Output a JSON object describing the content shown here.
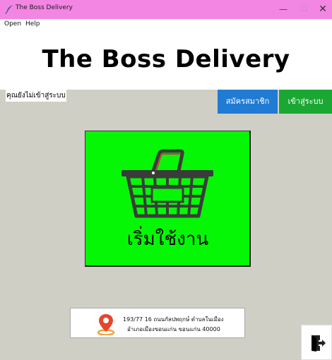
{
  "window": {
    "title": "The Boss Delivery",
    "controls": {
      "minimize": "—",
      "maximize": "☐",
      "close": "✕"
    }
  },
  "menu": {
    "items": [
      "Open",
      "Help"
    ]
  },
  "header": {
    "brand": "The Boss Delivery"
  },
  "status": {
    "text": "คุณยังไม่เข้าสู่ระบบ"
  },
  "actions": {
    "register_label": "สมัครสมาชิก",
    "login_label": "เข้าสู่ระบบ"
  },
  "start": {
    "label": "เริ่มใช้งาน",
    "icon": "shopping-basket-icon"
  },
  "address": {
    "line1": "193/77 16 ถนนกัลปพฤกษ์ ตำบลในเมือง",
    "line2": "อำเภอเมืองขอนแก่น ขอนแก่น 40000",
    "icon": "location-pin-icon"
  },
  "exit": {
    "icon": "exit-door-icon"
  },
  "colors": {
    "titlebar": "#f385e3",
    "background": "#d0cfc6",
    "register": "#1f7bd4",
    "login": "#1aa833",
    "start_panel": "#05f705",
    "pin": "#e8452c"
  }
}
